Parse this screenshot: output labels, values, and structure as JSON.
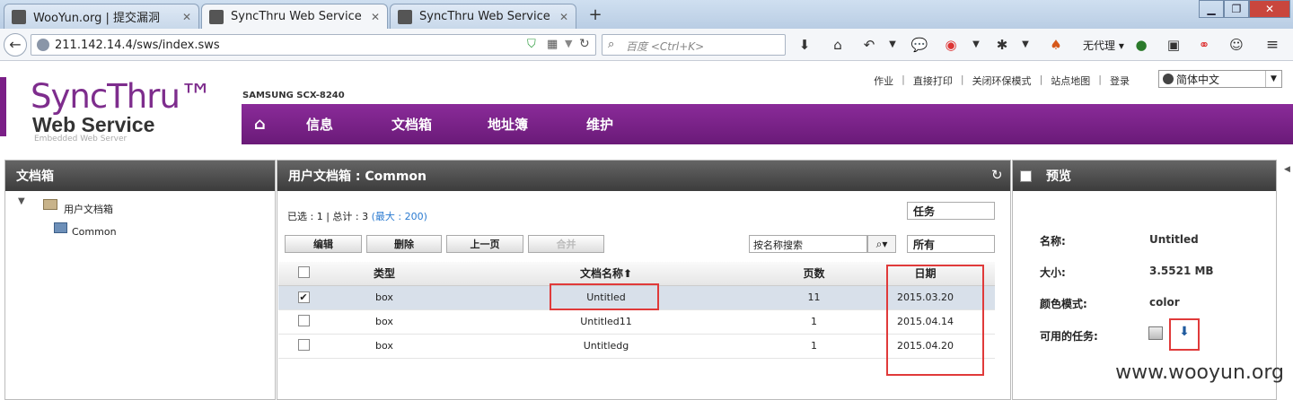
{
  "browser": {
    "tabs": [
      {
        "label": "WooYun.org | 提交漏洞",
        "active": false
      },
      {
        "label": "SyncThru Web Service",
        "active": true
      },
      {
        "label": "SyncThru Web Service",
        "active": false
      }
    ],
    "new_tab": "+",
    "url": "211.142.14.4/sws/index.sws",
    "search_placeholder": "百度 <Ctrl+K>",
    "proxy_label": "无代理",
    "window_buttons": [
      "▁",
      "❐",
      "✕"
    ]
  },
  "header": {
    "logo_line1": "SyncThru™",
    "logo_line2": "Web Service",
    "logo_line3": "Embedded Web Server",
    "model": "SAMSUNG SCX-8240",
    "top_links": [
      "作业",
      "直接打印",
      "关闭环保模式",
      "站点地图",
      "登录"
    ],
    "language": "简体中文",
    "nav": [
      "信息",
      "文档箱",
      "地址簿",
      "维护"
    ]
  },
  "left_panel": {
    "title": "文档箱",
    "tree_root": "用户文档箱",
    "tree_child": "Common"
  },
  "main_panel": {
    "title": "用户文档箱 : Common",
    "status_text": "已选 : 1 | 总计 : 3",
    "status_max": "(最大 : 200)",
    "task_select": "任务",
    "filter_select": "所有",
    "search_placeholder": "按名称搜索",
    "buttons": {
      "edit": "编辑",
      "delete": "删除",
      "upload": "上一页",
      "merge": "合并"
    },
    "columns": {
      "type": "类型",
      "name": "文档名称",
      "pages": "页数",
      "date": "日期"
    },
    "rows": [
      {
        "checked": true,
        "type": "box",
        "name": "Untitled",
        "pages": "11",
        "date": "2015.03.20"
      },
      {
        "checked": false,
        "type": "box",
        "name": "Untitled11",
        "pages": "1",
        "date": "2015.04.14"
      },
      {
        "checked": false,
        "type": "box",
        "name": "Untitledg",
        "pages": "1",
        "date": "2015.04.20"
      }
    ]
  },
  "preview_panel": {
    "title": "预览",
    "name_label": "名称:",
    "name_value": "Untitled",
    "size_label": "大小:",
    "size_value": "3.5521 MB",
    "color_label": "颜色模式:",
    "color_value": "color",
    "tasks_label": "可用的任务:"
  },
  "watermark": "www.wooyun.org",
  "colors": {
    "brand_purple": "#7b1f87",
    "highlight_red": "#e03a3a",
    "selected_row": "#d8e0ea"
  }
}
